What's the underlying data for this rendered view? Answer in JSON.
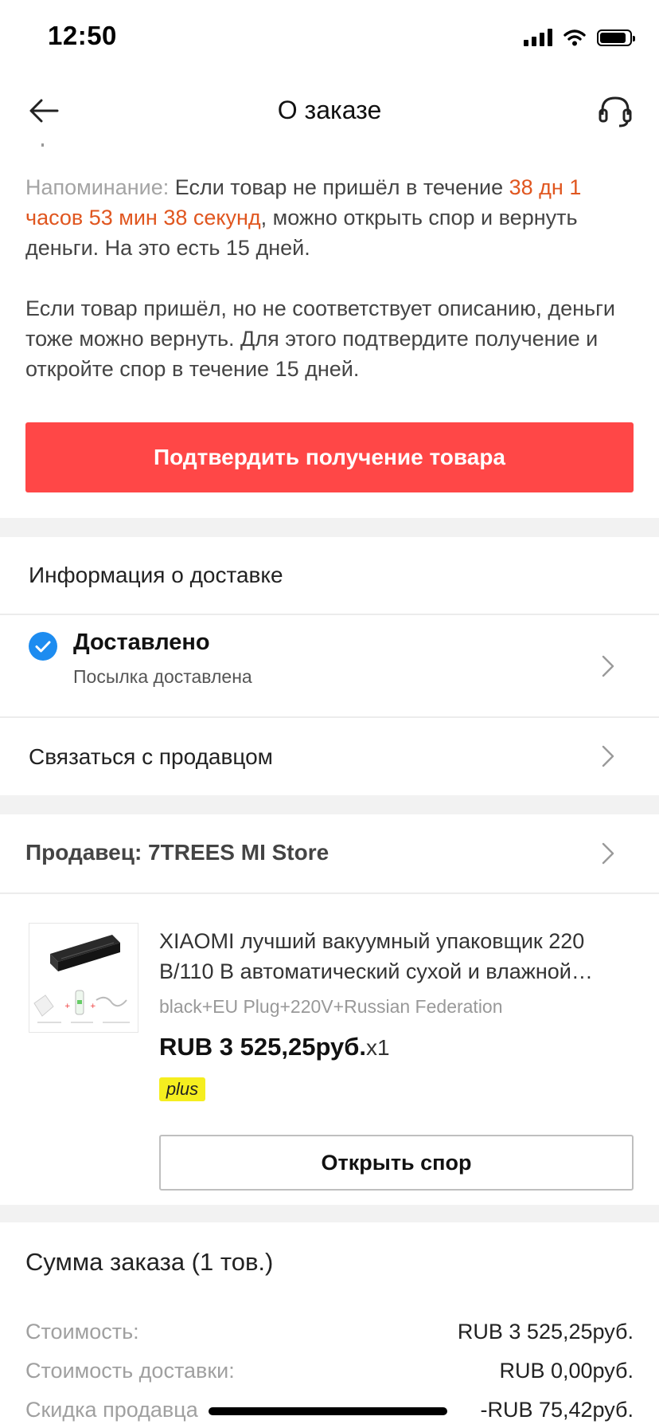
{
  "status_bar": {
    "time": "12:50"
  },
  "header": {
    "title": "О заказе",
    "back_icon": "arrow-left-icon",
    "support_icon": "headset-icon"
  },
  "reminder": {
    "label": "Напоминание: ",
    "text_before_timer": "Если товар не пришёл в течение ",
    "timer": "38 дн 1 часов 53 мин 38 секунд",
    "text_after_timer": ", можно открыть спор и вернуть деньги. На это есть 15 дней.",
    "paragraph2": "Если товар пришёл, но не соответствует описанию, деньги тоже можно вернуть. Для этого подтвердите получение и откройте спор в течение 15 дней."
  },
  "confirm_button": {
    "label": "Подтвердить получение товара",
    "color": "#ff4747"
  },
  "delivery": {
    "section_title": "Информация о доставке",
    "status": "Доставлено",
    "status_sub": "Посылка доставлена",
    "status_color": "#1d8cf0"
  },
  "contact_seller": {
    "label": "Связаться с продавцом"
  },
  "seller": {
    "label": "Продавец: 7TREES MI Store"
  },
  "product": {
    "title_line1": "XIAOMI лучший вакуумный упаковщик 220",
    "title_line2": "В/110 В автоматический сухой и влажной…",
    "variant": "black+EU Plug+220V+Russian Federation",
    "price": "RUB 3 525,25руб.",
    "quantity": "x1",
    "badge": "plus",
    "badge_color": "#f5ee1f"
  },
  "dispute_button": {
    "label": "Открыть спор"
  },
  "summary": {
    "title": "Сумма заказа (1 тов.)",
    "rows": [
      {
        "label": "Стоимость:",
        "value": "RUB 3 525,25руб."
      },
      {
        "label": "Стоимость доставки:",
        "value": "RUB 0,00руб."
      },
      {
        "label": "Скидка продавца",
        "value": "-RUB 75,42руб."
      }
    ]
  },
  "accent_color": "#e0561f"
}
